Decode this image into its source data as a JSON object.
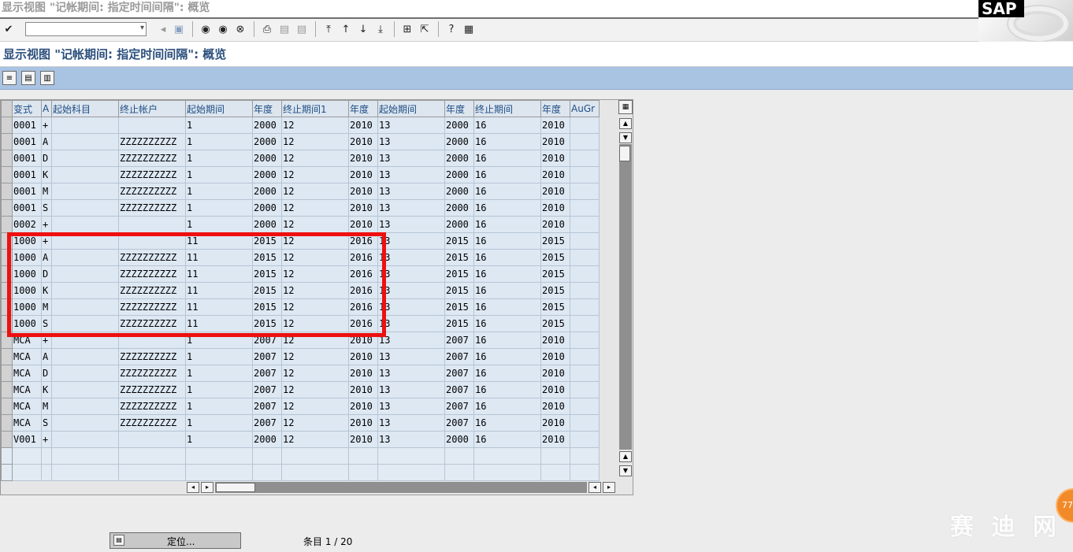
{
  "window": {
    "title": "显示视图 \"记帐期间: 指定时间间隔\": 概览"
  },
  "logo": {
    "text": "SAP"
  },
  "command_field": {
    "value": ""
  },
  "screen_title": "显示视图 \"记帐期间: 指定时间间隔\": 概览",
  "table": {
    "columns": [
      "变式",
      "A",
      "起始科目",
      "终止帐户",
      "起始期间",
      "年度",
      "终止期间1",
      "年度",
      "起始期间",
      "年度",
      "终止期间",
      "年度",
      "AuGr"
    ],
    "rows": [
      [
        "0001",
        "+",
        "",
        "",
        "1",
        "2000",
        "12",
        "2010",
        "13",
        "2000",
        "16",
        "2010",
        ""
      ],
      [
        "0001",
        "A",
        "",
        "ZZZZZZZZZZ",
        "1",
        "2000",
        "12",
        "2010",
        "13",
        "2000",
        "16",
        "2010",
        ""
      ],
      [
        "0001",
        "D",
        "",
        "ZZZZZZZZZZ",
        "1",
        "2000",
        "12",
        "2010",
        "13",
        "2000",
        "16",
        "2010",
        ""
      ],
      [
        "0001",
        "K",
        "",
        "ZZZZZZZZZZ",
        "1",
        "2000",
        "12",
        "2010",
        "13",
        "2000",
        "16",
        "2010",
        ""
      ],
      [
        "0001",
        "M",
        "",
        "ZZZZZZZZZZ",
        "1",
        "2000",
        "12",
        "2010",
        "13",
        "2000",
        "16",
        "2010",
        ""
      ],
      [
        "0001",
        "S",
        "",
        "ZZZZZZZZZZ",
        "1",
        "2000",
        "12",
        "2010",
        "13",
        "2000",
        "16",
        "2010",
        ""
      ],
      [
        "0002",
        "+",
        "",
        "",
        "1",
        "2000",
        "12",
        "2010",
        "13",
        "2000",
        "16",
        "2010",
        ""
      ],
      [
        "1000",
        "+",
        "",
        "",
        "11",
        "2015",
        "12",
        "2016",
        "13",
        "2015",
        "16",
        "2015",
        ""
      ],
      [
        "1000",
        "A",
        "",
        "ZZZZZZZZZZ",
        "11",
        "2015",
        "12",
        "2016",
        "13",
        "2015",
        "16",
        "2015",
        ""
      ],
      [
        "1000",
        "D",
        "",
        "ZZZZZZZZZZ",
        "11",
        "2015",
        "12",
        "2016",
        "13",
        "2015",
        "16",
        "2015",
        ""
      ],
      [
        "1000",
        "K",
        "",
        "ZZZZZZZZZZ",
        "11",
        "2015",
        "12",
        "2016",
        "13",
        "2015",
        "16",
        "2015",
        ""
      ],
      [
        "1000",
        "M",
        "",
        "ZZZZZZZZZZ",
        "11",
        "2015",
        "12",
        "2016",
        "13",
        "2015",
        "16",
        "2015",
        ""
      ],
      [
        "1000",
        "S",
        "",
        "ZZZZZZZZZZ",
        "11",
        "2015",
        "12",
        "2016",
        "13",
        "2015",
        "16",
        "2015",
        ""
      ],
      [
        "MCA",
        "+",
        "",
        "",
        "1",
        "2007",
        "12",
        "2010",
        "13",
        "2007",
        "16",
        "2010",
        ""
      ],
      [
        "MCA",
        "A",
        "",
        "ZZZZZZZZZZ",
        "1",
        "2007",
        "12",
        "2010",
        "13",
        "2007",
        "16",
        "2010",
        ""
      ],
      [
        "MCA",
        "D",
        "",
        "ZZZZZZZZZZ",
        "1",
        "2007",
        "12",
        "2010",
        "13",
        "2007",
        "16",
        "2010",
        ""
      ],
      [
        "MCA",
        "K",
        "",
        "ZZZZZZZZZZ",
        "1",
        "2007",
        "12",
        "2010",
        "13",
        "2007",
        "16",
        "2010",
        ""
      ],
      [
        "MCA",
        "M",
        "",
        "ZZZZZZZZZZ",
        "1",
        "2007",
        "12",
        "2010",
        "13",
        "2007",
        "16",
        "2010",
        ""
      ],
      [
        "MCA",
        "S",
        "",
        "ZZZZZZZZZZ",
        "1",
        "2007",
        "12",
        "2010",
        "13",
        "2007",
        "16",
        "2010",
        ""
      ],
      [
        "V001",
        "+",
        "",
        "",
        "1",
        "2000",
        "12",
        "2010",
        "13",
        "2000",
        "16",
        "2010",
        ""
      ]
    ],
    "empty_rows": 2
  },
  "bottom": {
    "position_button_label": "定位...",
    "entry_counter": "条目 1 / 20"
  },
  "watermark": {
    "text": "赛 迪 网"
  },
  "badge": {
    "text": "77"
  },
  "colors": {
    "highlight": "#ee1010",
    "header_text": "#1f4d86",
    "app_toolbar": "#a9c3e2"
  }
}
